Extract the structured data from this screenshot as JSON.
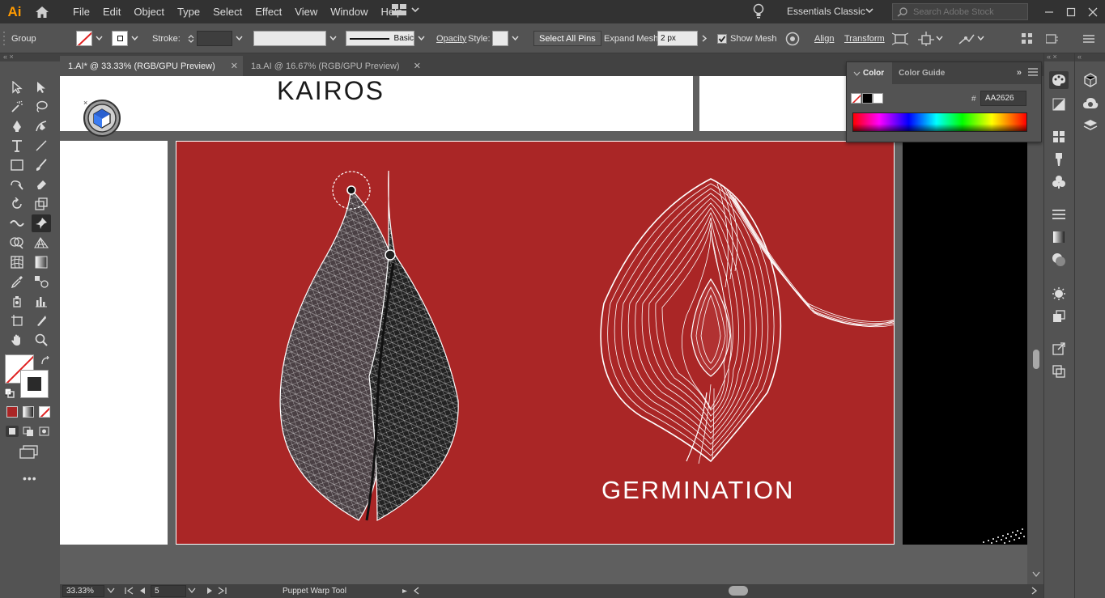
{
  "app": {
    "logo": "Ai"
  },
  "menu": [
    "File",
    "Edit",
    "Object",
    "Type",
    "Select",
    "Effect",
    "View",
    "Window",
    "Help"
  ],
  "workspace": {
    "name": "Essentials Classic"
  },
  "search": {
    "placeholder": "Search Adobe Stock"
  },
  "control_bar": {
    "selection": "Group",
    "stroke_label": "Stroke:",
    "brush_label": "Basic",
    "opacity_label": "Opacity",
    "style_label": "Style:",
    "select_all_pins": "Select All Pins",
    "expand_mesh_label": "Expand Mesh:",
    "expand_mesh_value": "2 px",
    "show_mesh_label": "Show Mesh",
    "show_mesh_checked": true,
    "align": "Align",
    "transform": "Transform"
  },
  "tabs": [
    {
      "label": "1.AI* @ 33.33% (RGB/GPU Preview)",
      "active": true
    },
    {
      "label": "1a.AI @ 16.67% (RGB/GPU Preview)",
      "active": false
    }
  ],
  "artboard": {
    "top_title": "KAIROS",
    "caption": "GERMINATION",
    "background_color": "#AA2626"
  },
  "color_panel": {
    "tab_color": "Color",
    "tab_guide": "Color Guide",
    "hex_label": "#",
    "hex_value": "AA2626"
  },
  "status": {
    "zoom": "33.33%",
    "artboard_number": "5",
    "tool": "Puppet Warp Tool"
  },
  "colors": {
    "accent_fill": "#AA2626",
    "ui_dark": "#323232",
    "ui_mid": "#535353"
  },
  "icons": [
    "home-icon",
    "bulb-icon",
    "search-icon",
    "selection-tool-icon",
    "direct-selection-tool-icon",
    "puppet-warp-tool-icon",
    "zoom-tool-icon",
    "hand-tool-icon"
  ]
}
